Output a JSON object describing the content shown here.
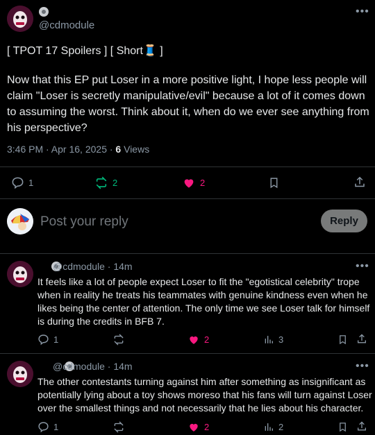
{
  "post": {
    "handle": "@cdmodule",
    "title_line": "[ TPOT 17 Spoilers ] [ Short🧵 ]",
    "body": "Now that this EP put Loser in a more positive light, I hope less people will claim \"Loser is secretly manipulative/evil\" because a lot of it comes down to assuming the worst. Think about it, when do we ever see anything from his perspective?",
    "timestamp": "3:46 PM · Apr 16, 2025 · ",
    "views_count": "6",
    "views_label": " Views",
    "replies": "1",
    "reposts": "2",
    "likes": "2"
  },
  "reply_box": {
    "placeholder": "Post your reply",
    "button": "Reply"
  },
  "comments": [
    {
      "handle": "@cdmodule · 14m",
      "text": "It feels like a lot of people expect Loser to fit the \"egotistical celebrity\" trope when in reality he treats his teammates with genuine kindness even when he likes being the center of attention. The only time we see Loser talk for himself is during the credits in BFB 7.",
      "replies": "1",
      "likes": "2",
      "views": "3"
    },
    {
      "handle": "@cdmodule · 14m",
      "text": "The other contestants turning against him after something as insignificant as potentially lying about a toy shows moreso that his fans will turn against Loser over the smallest things and not necessarily that he lies about his character.",
      "replies": "1",
      "likes": "2",
      "views": "2"
    }
  ],
  "colors": {
    "like": "#f91880",
    "repost": "#00ba7c",
    "muted": "#8b98a5",
    "background": "#000000"
  }
}
